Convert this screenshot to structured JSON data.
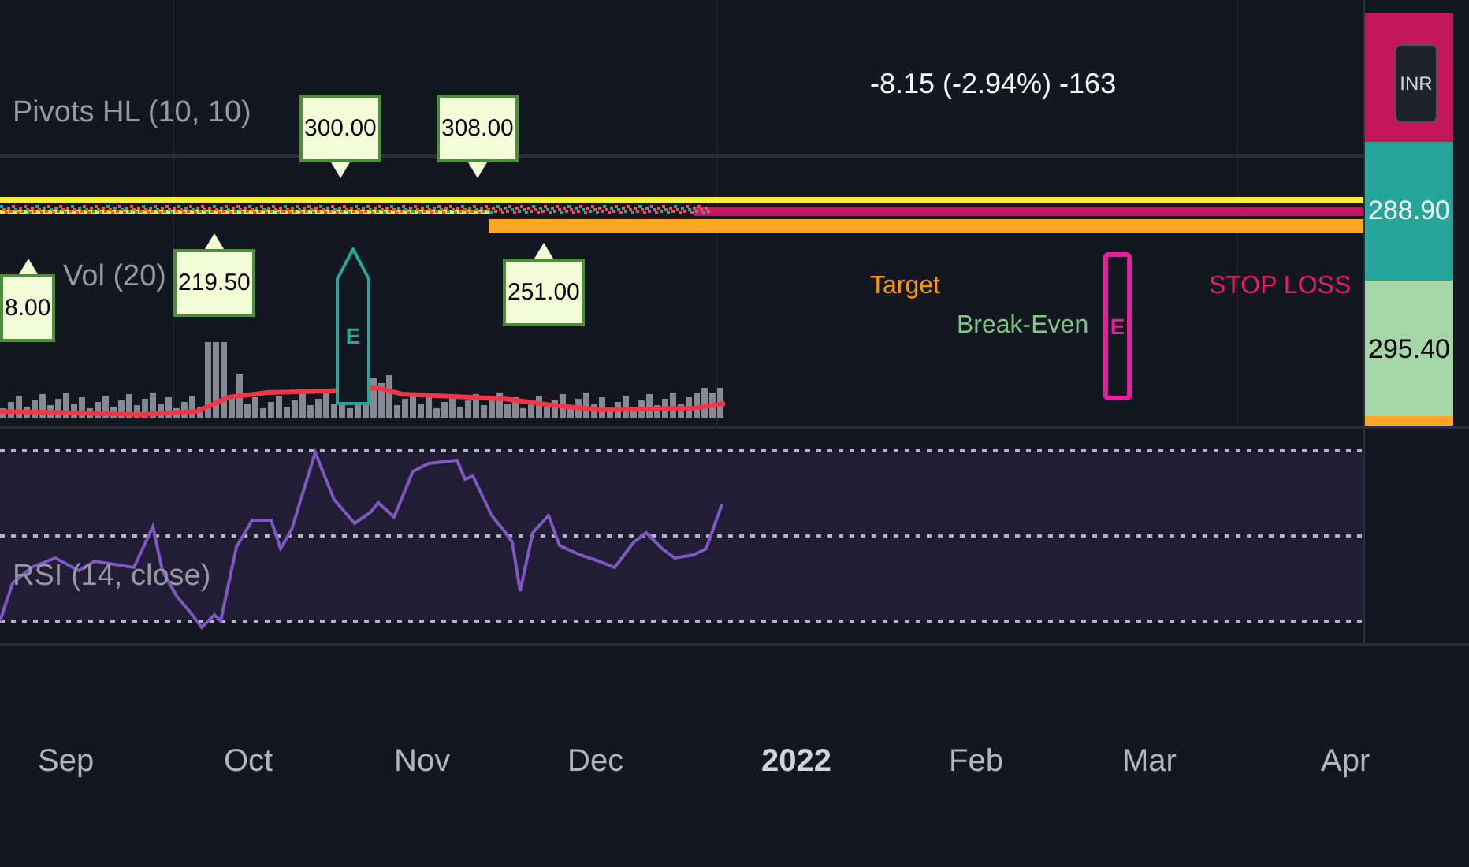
{
  "header": {
    "change": "-8.15 (-2.94%) -163"
  },
  "legends": [
    {
      "kind": "price",
      "text": "Pivots HL (10, 10)"
    },
    {
      "kind": "volume",
      "text": "Vol (20)"
    },
    {
      "kind": "rsi",
      "text": "RSI (14, close)"
    }
  ],
  "pivots": [
    {
      "label": "8.00",
      "kind": "low"
    },
    {
      "label": "219.50",
      "kind": "low"
    },
    {
      "label": "300.00",
      "kind": "high"
    },
    {
      "label": "308.00",
      "kind": "high"
    },
    {
      "label": "251.00",
      "kind": "low"
    }
  ],
  "markers": [
    {
      "kind": "arrow",
      "text": "E",
      "color": "#26a69a"
    },
    {
      "kind": "box",
      "text": "E",
      "color": "#e91e9e"
    }
  ],
  "trade_labels": [
    {
      "text": "Target",
      "color": "#ff9800"
    },
    {
      "text": "Break-Even",
      "color": "#81c784"
    },
    {
      "text": "STOP LOSS",
      "color": "#e91e63"
    }
  ],
  "price_axis": {
    "labels": [
      {
        "color": "#c2185b"
      },
      {
        "text": "288.90",
        "color": "#26a69a"
      },
      {
        "text": "295.40",
        "color": "#a5d6a7"
      }
    ],
    "currency": "INR"
  },
  "time_axis": [
    {
      "text": "Sep",
      "bold": false
    },
    {
      "text": "Oct",
      "bold": false
    },
    {
      "text": "Nov",
      "bold": false
    },
    {
      "text": "Dec",
      "bold": false
    },
    {
      "text": "2022",
      "bold": true
    },
    {
      "text": "Feb",
      "bold": false
    },
    {
      "text": "Mar",
      "bold": false
    },
    {
      "text": "Apr",
      "bold": false
    }
  ]
}
